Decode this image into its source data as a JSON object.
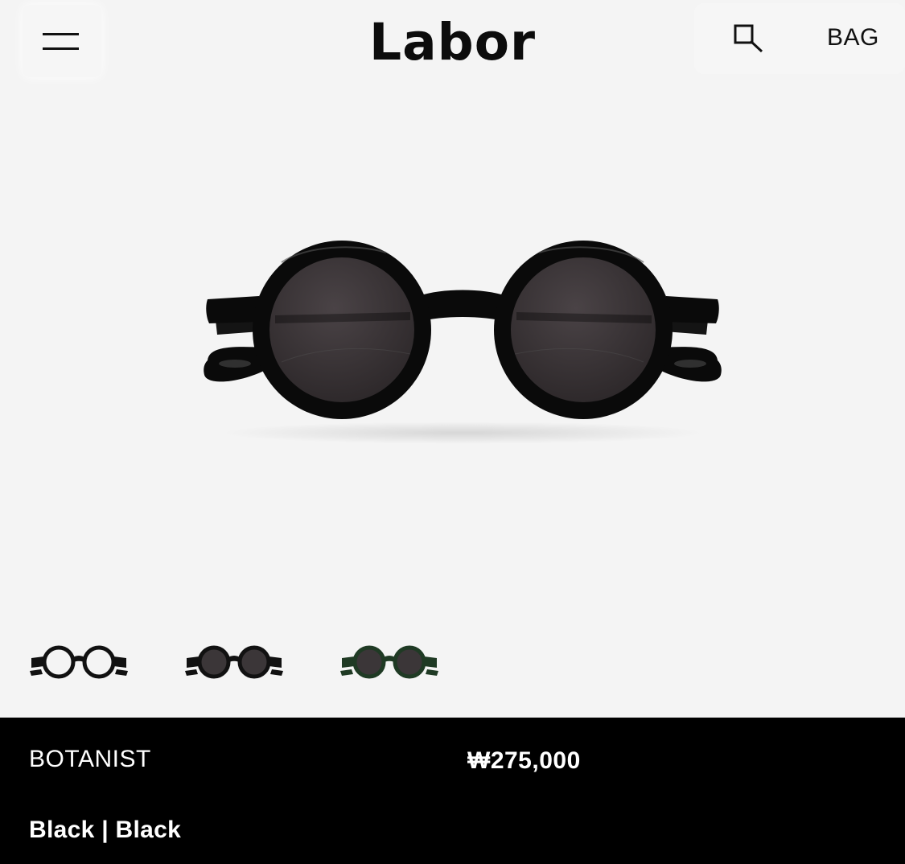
{
  "header": {
    "brand": "Labor",
    "bag_label": "BAG",
    "menu_icon": "hamburger-menu-icon",
    "search_icon": "search-icon"
  },
  "product": {
    "name": "BOTANIST",
    "price": "₩275,000",
    "color": "Black | Black",
    "main_image": "black-round-sunglasses",
    "thumbnails": [
      {
        "variant": "black-frame-clear-lens"
      },
      {
        "variant": "black-frame-dark-lens"
      },
      {
        "variant": "green-frame-dark-lens"
      }
    ]
  },
  "colors": {
    "background": "#f4f4f4",
    "panel": "#000000",
    "text_light": "#ffffff",
    "text_dark": "#111111",
    "frame_black": "#0a0a0a",
    "lens_dark": "#3b3638",
    "frame_green": "#1f3a24"
  }
}
